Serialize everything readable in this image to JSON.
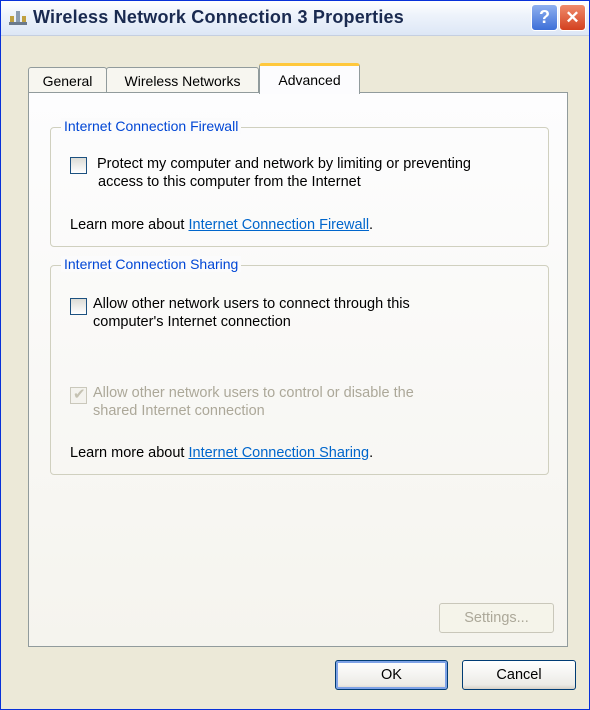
{
  "window": {
    "title": "Wireless Network Connection 3 Properties",
    "help_label": "?",
    "close_label": "✕"
  },
  "tabs": [
    {
      "label": "General",
      "active": false
    },
    {
      "label": "Wireless Networks",
      "active": false
    },
    {
      "label": "Advanced",
      "active": true
    }
  ],
  "firewall": {
    "legend": "Internet Connection Firewall",
    "checkbox_label_line1": "Protect my computer and network by limiting or preventing",
    "checkbox_label_line2": "access to this computer from the Internet",
    "checked": false,
    "learn_prefix": "Learn more about ",
    "learn_link": "Internet Connection Firewall",
    "learn_suffix": "."
  },
  "sharing": {
    "legend": "Internet Connection Sharing",
    "allow_connect_line1": "Allow other network users to connect through this",
    "allow_connect_line2": "computer's Internet connection",
    "allow_connect_checked": false,
    "allow_control_line1": "Allow other network users to control or disable the",
    "allow_control_line2": "shared Internet connection",
    "allow_control_checked": true,
    "allow_control_disabled": true,
    "learn_prefix": "Learn more about ",
    "learn_link": "Internet Connection Sharing",
    "learn_suffix": "."
  },
  "buttons": {
    "settings": "Settings...",
    "ok": "OK",
    "cancel": "Cancel"
  },
  "colors": {
    "group_title": "#0046d5",
    "link": "#0066cc",
    "window_bg": "#ECE9D8"
  }
}
